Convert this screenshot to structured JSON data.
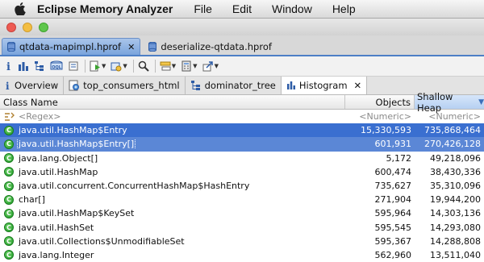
{
  "menubar": {
    "app_name": "Eclipse Memory Analyzer",
    "items": [
      "File",
      "Edit",
      "Window",
      "Help"
    ]
  },
  "editor_tabs": [
    {
      "label": "qtdata-mapimpl.hprof",
      "active": true
    },
    {
      "label": "deserialize-qtdata.hprof",
      "active": false
    }
  ],
  "view_tabs": [
    {
      "label": "Overview",
      "icon": "info-icon"
    },
    {
      "label": "top_consumers_html",
      "icon": "report-icon"
    },
    {
      "label": "dominator_tree",
      "icon": "tree-icon"
    },
    {
      "label": "Histogram",
      "icon": "histogram-icon",
      "active": true
    }
  ],
  "table": {
    "headers": {
      "class_name": "Class Name",
      "objects": "Objects",
      "shallow_heap": "Shallow Heap"
    },
    "filter": {
      "class_name": "<Regex>",
      "objects": "<Numeric>",
      "shallow_heap": "<Numeric>"
    },
    "rows": [
      {
        "name": "java.util.HashMap$Entry",
        "objects": "15,330,593",
        "heap": "735,868,464"
      },
      {
        "name": "java.util.HashMap$Entry[]",
        "objects": "601,931",
        "heap": "270,426,128"
      },
      {
        "name": "java.lang.Object[]",
        "objects": "5,172",
        "heap": "49,218,096"
      },
      {
        "name": "java.util.HashMap",
        "objects": "600,474",
        "heap": "38,430,336"
      },
      {
        "name": "java.util.concurrent.ConcurrentHashMap$HashEntry",
        "objects": "735,627",
        "heap": "35,310,096"
      },
      {
        "name": "char[]",
        "objects": "271,904",
        "heap": "19,944,200"
      },
      {
        "name": "java.util.HashMap$KeySet",
        "objects": "595,964",
        "heap": "14,303,136"
      },
      {
        "name": "java.util.HashSet",
        "objects": "595,545",
        "heap": "14,293,080"
      },
      {
        "name": "java.util.Collections$UnmodifiableSet",
        "objects": "595,367",
        "heap": "14,288,808"
      },
      {
        "name": "java.lang.Integer",
        "objects": "562,960",
        "heap": "13,511,040"
      }
    ]
  },
  "colors": {
    "selection": "#3a6fd0",
    "selection_secondary": "#5b87d6",
    "sorted_header": "#b6d0f2"
  }
}
